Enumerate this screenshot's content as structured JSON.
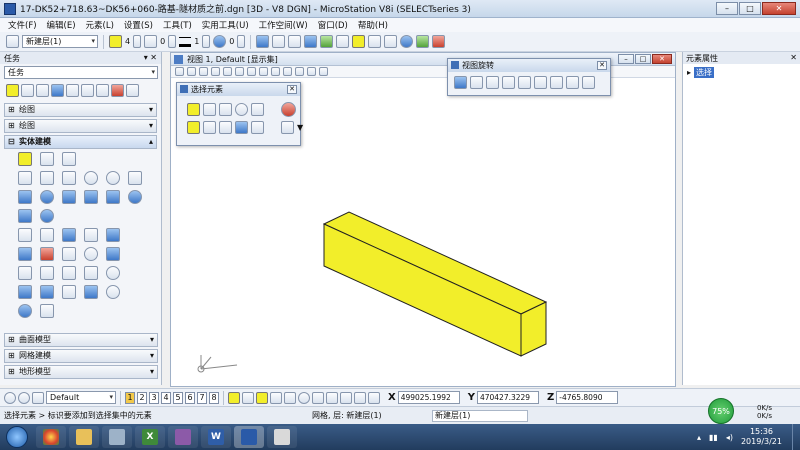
{
  "window": {
    "title": "17-DK52+718.63~DK56+060-路基-隧材质之前.dgn [3D - V8 DGN] - MicroStation V8i (SELECTseries 3)"
  },
  "menu": [
    "文件(F)",
    "编辑(E)",
    "元素(L)",
    "设置(S)",
    "工具(T)",
    "实用工具(U)",
    "工作空间(W)",
    "窗口(D)",
    "帮助(H)"
  ],
  "attributes_toolbar": {
    "level": "新建层(1)",
    "color_value": "4",
    "style_value": "0",
    "weight_value": "1",
    "transparency_value": "0",
    "active_color_hex": "#f2ee2a"
  },
  "task_panel": {
    "header": "任务",
    "task_combo": "任务",
    "sections_top": [
      "绘图",
      "绘图"
    ],
    "solid_section": "实体建模",
    "sections_bottom": [
      "曲面模型",
      "网格建模",
      "地形模型"
    ]
  },
  "view": {
    "title": "视图 1, Default [显示集]"
  },
  "select_palette": {
    "title": "选择元素"
  },
  "view_rotation_palette": {
    "title": "视图旋转"
  },
  "right_panel": {
    "header": "元素属性",
    "selection": "选择"
  },
  "bottom_bar": {
    "view_combo": "Default",
    "view_numbers": [
      "1",
      "2",
      "3",
      "4",
      "5",
      "6",
      "7",
      "8"
    ],
    "x_label": "X",
    "x_value": "499025.1992",
    "y_label": "Y",
    "y_value": "470427.3229",
    "z_label": "Z",
    "z_value": "-4765.8090"
  },
  "status": {
    "message": "选择元素 > 标识要添加到选择集中的元素",
    "level_label": "网格, 层: 新建层(1)",
    "level_field": "新建层(1)",
    "gauge_percent": "75%",
    "net_up": "0K/s",
    "net_down": "0K/s"
  },
  "taskbar": {
    "time": "15:36",
    "date": "2019/3/21"
  },
  "beam": {
    "fill": "#f2ee2a",
    "stroke": "#222222"
  }
}
